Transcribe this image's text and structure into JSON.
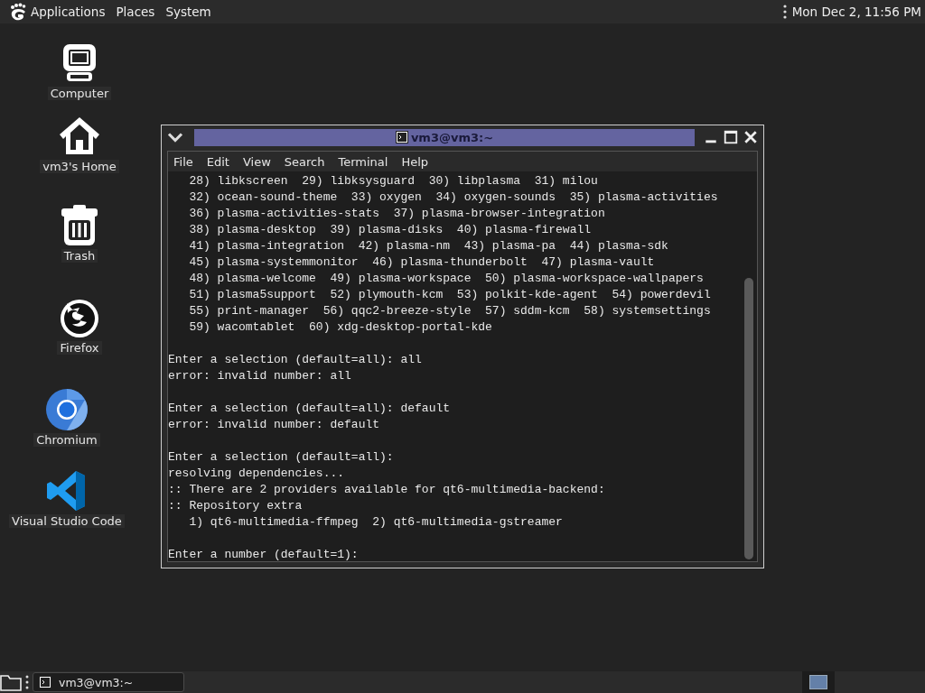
{
  "top_panel": {
    "menus": [
      "Applications",
      "Places",
      "System"
    ],
    "clock": "Mon Dec 2, 11:56 PM"
  },
  "desktop_icons": [
    {
      "kind": "computer",
      "label": "Computer"
    },
    {
      "kind": "home",
      "label": "vm3's Home"
    },
    {
      "kind": "trash",
      "label": "Trash"
    },
    {
      "kind": "firefox",
      "label": "Firefox"
    },
    {
      "kind": "chromium",
      "label": "Chromium"
    },
    {
      "kind": "vscode",
      "label": "Visual Studio Code"
    }
  ],
  "window": {
    "title": "vm3@vm3:~",
    "menu": [
      "File",
      "Edit",
      "View",
      "Search",
      "Terminal",
      "Help"
    ],
    "blocks": [
      [
        "   28) libkscreen  29) libksysguard  30) libplasma  31) milou",
        "   32) ocean-sound-theme  33) oxygen  34) oxygen-sounds  35) plasma-activities",
        "   36) plasma-activities-stats  37) plasma-browser-integration",
        "   38) plasma-desktop  39) plasma-disks  40) plasma-firewall",
        "   41) plasma-integration  42) plasma-nm  43) plasma-pa  44) plasma-sdk",
        "   45) plasma-systemmonitor  46) plasma-thunderbolt  47) plasma-vault",
        "   48) plasma-welcome  49) plasma-workspace  50) plasma-workspace-wallpapers",
        "   51) plasma5support  52) plymouth-kcm  53) polkit-kde-agent  54) powerdevil",
        "   55) print-manager  56) qqc2-breeze-style  57) sddm-kcm  58) systemsettings",
        "   59) wacomtablet  60) xdg-desktop-portal-kde"
      ],
      [
        "Enter a selection (default=all): all",
        "error: invalid number: all"
      ],
      [
        "Enter a selection (default=all): default",
        "error: invalid number: default"
      ],
      [
        "Enter a selection (default=all):",
        "resolving dependencies...",
        ":: There are 2 providers available for qt6-multimedia-backend:",
        ":: Repository extra",
        "   1) qt6-multimedia-ffmpeg  2) qt6-multimedia-gstreamer"
      ],
      [
        "Enter a number (default=1):"
      ]
    ]
  },
  "taskbar": {
    "tasks": [
      {
        "title": "vm3@vm3:~"
      }
    ],
    "workspaces": [
      {
        "selected": true
      }
    ]
  }
}
